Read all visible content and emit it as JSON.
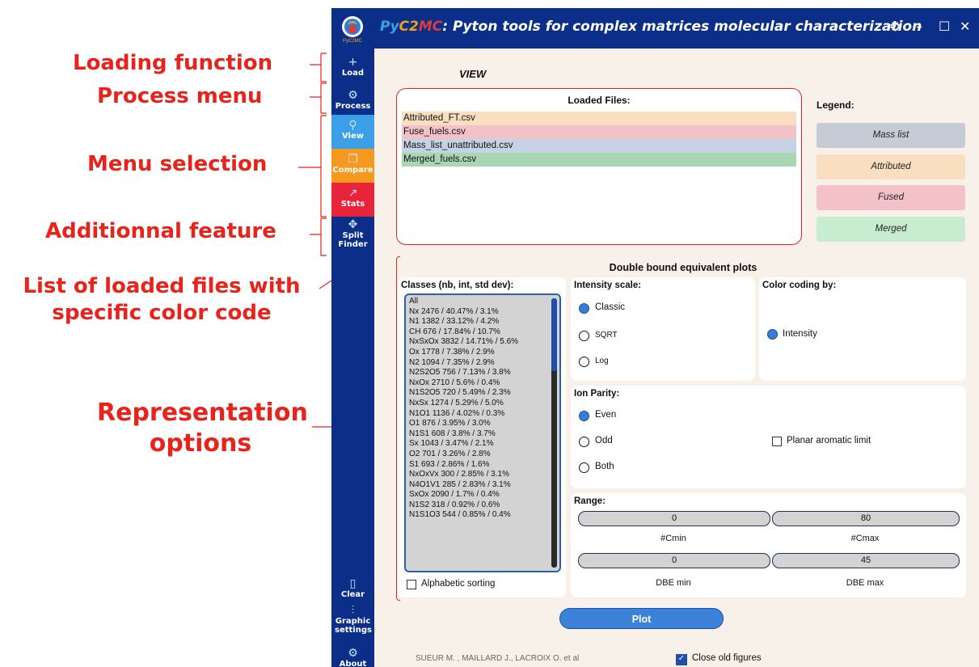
{
  "annotations": {
    "loading": "Loading function",
    "process": "Process menu",
    "menu": "Menu selection",
    "additional": "Additionnal feature",
    "list_line1": "List of loaded files with",
    "list_line2": "specific color code",
    "repr_line1": "Representation",
    "repr_line2": "options"
  },
  "window": {
    "title_py": "Py",
    "title_c2": "C2",
    "title_mc": "MC",
    "title_rest": ": Pyton tools for complex matrices molecular characterization",
    "logo_text": "PyC2MC"
  },
  "sidebar": {
    "items": [
      {
        "label": "Load",
        "icon": "plus-icon",
        "glyph": "+"
      },
      {
        "label": "Process",
        "icon": "gear-icon",
        "glyph": "⚙"
      },
      {
        "label": "View",
        "icon": "search-icon",
        "glyph": "⚲",
        "active_color": "#3ba0e8"
      },
      {
        "label": "Compare",
        "icon": "copy-icon",
        "glyph": "❐",
        "active_color": "#f59a1e"
      },
      {
        "label": "Stats",
        "icon": "chart-icon",
        "glyph": "↗",
        "active_color": "#e8233a"
      },
      {
        "label": "Split Finder",
        "icon": "move-icon",
        "glyph": "✥"
      }
    ],
    "bottom": [
      {
        "label": "Clear",
        "icon": "file-icon",
        "glyph": "🗋"
      },
      {
        "label": "Graphic settings",
        "icon": "sliders-icon",
        "glyph": "⫶"
      },
      {
        "label": "About",
        "icon": "gear-icon",
        "glyph": "⚙"
      }
    ]
  },
  "view": {
    "title": "VIEW",
    "loaded_title": "Loaded Files:",
    "files": [
      {
        "name": "Attributed_FT.csv",
        "color": "#f9dfc0"
      },
      {
        "name": "Fuse_fuels.csv",
        "color": "#f3c2c8"
      },
      {
        "name": "Mass_list_unattributed.csv",
        "color": "#c5d3e4"
      },
      {
        "name": "Merged_fuels.csv",
        "color": "#a9d6b3"
      }
    ],
    "legend_title": "Legend:",
    "legend": [
      {
        "label": "Mass list",
        "color": "#c6ccd5"
      },
      {
        "label": "Attributed",
        "color": "#f9dfc0"
      },
      {
        "label": "Fused",
        "color": "#f3c2c8"
      },
      {
        "label": "Merged",
        "color": "#c8ecd0"
      }
    ]
  },
  "dbe": {
    "title": "Double bound equivalent plots",
    "classes_title": "Classes (nb, int, std dev):",
    "classes": [
      "All",
      "Nx 2476 / 40.47% / 3.1%",
      "N1 1382 / 33.12% / 4.2%",
      "CH 676 / 17.84% / 10.7%",
      "NxSxOx 3832 / 14.71% / 5.6%",
      "Ox 1778 / 7.38% / 2.9%",
      "N2 1094 / 7.35% / 2.9%",
      "N2S2O5 756 / 7.13% / 3.8%",
      "NxOx 2710 / 5.6% / 0.4%",
      "N1S2O5 720 / 5.49% / 2.3%",
      "NxSx 1274 / 5.29% / 5.0%",
      "N1O1 1136 / 4.02% / 0.3%",
      "O1 876 / 3.95% / 3.0%",
      "N1S1 608 / 3.8% / 3.7%",
      "Sx 1043 / 3.47% / 2.1%",
      "O2 701 / 3.26% / 2.8%",
      "S1 693 / 2.86% / 1.6%",
      "NxOxVx 300 / 2.85% / 3.1%",
      "N4O1V1 285 / 2.83% / 3.1%",
      "SxOx 2090 / 1.7% / 0.4%",
      "N1S2 318 / 0.92% / 0.6%",
      "N1S1O3 544 / 0.85% / 0.4%"
    ],
    "alphabetic_label": "Alphabetic sorting",
    "intensity_title": "Intensity scale:",
    "intensity_options": [
      "Classic",
      "SQRT",
      "Log"
    ],
    "color_title": "Color coding by:",
    "color_option": "Intensity",
    "parity_title": "Ion Parity:",
    "parity_options": [
      "Even",
      "Odd",
      "Both"
    ],
    "planar_label": "Planar aromatic limit",
    "range_title": "Range:",
    "cmin_value": "0",
    "cmax_value": "80",
    "cmin_label": "#Cmin",
    "cmax_label": "#Cmax",
    "dbemin_value": "0",
    "dbemax_value": "45",
    "dbemin_label": "DBE min",
    "dbemax_label": "DBE max"
  },
  "plot_label": "Plot",
  "authors": "SUEUR M. , MAILLARD J., LACROIX O. et al",
  "close_old_label": "Close old figures"
}
